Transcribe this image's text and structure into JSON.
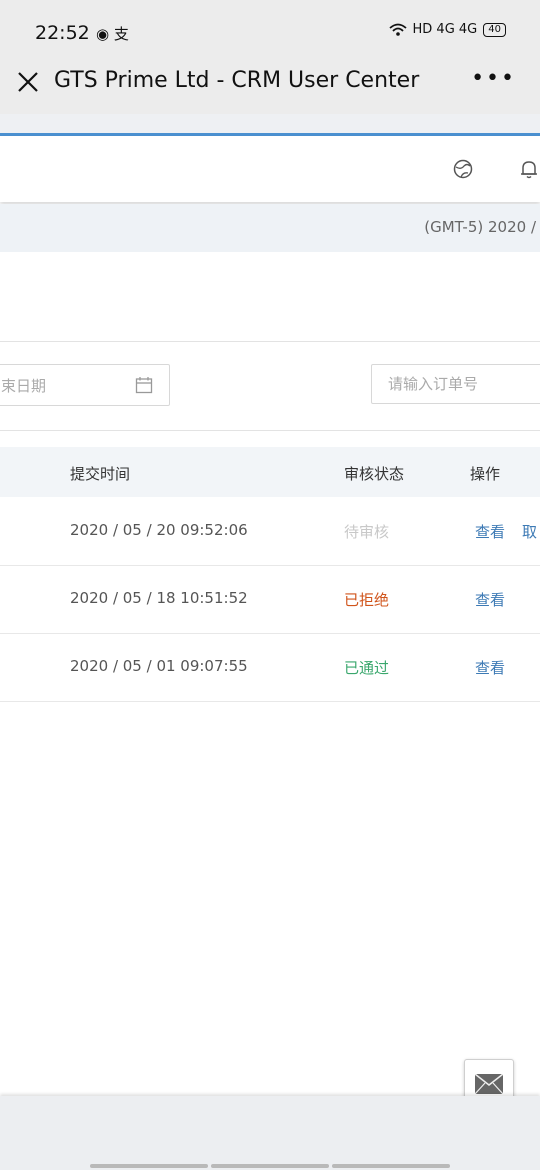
{
  "status_bar": {
    "time": "22:52",
    "left_icons": "◉ 支",
    "network": "HD 4G 4G",
    "battery": "40"
  },
  "title_bar": {
    "title": "GTS Prime Ltd - CRM User Center",
    "more": "•••"
  },
  "timezone_text": "(GMT-5) 2020 /",
  "filters": {
    "end_date_placeholder": "束日期",
    "order_placeholder": "请输入订单号"
  },
  "table": {
    "headers": {
      "submit_time": "提交时间",
      "status": "审核状态",
      "action": "操作"
    },
    "rows": [
      {
        "time": "2020 / 05 / 20 09:52:06",
        "status": "待审核",
        "status_color": "#c8c8c8",
        "view": "查看",
        "cancel": "取"
      },
      {
        "time": "2020 / 05 / 18 10:51:52",
        "status": "已拒绝",
        "status_color": "#d0541b",
        "view": "查看"
      },
      {
        "time": "2020 / 05 / 01 09:07:55",
        "status": "已通过",
        "status_color": "#3aa76d",
        "view": "查看"
      }
    ]
  },
  "icons": [
    "close-icon",
    "more-icon",
    "globe-icon",
    "bell-icon",
    "calendar-icon",
    "mail-icon"
  ]
}
